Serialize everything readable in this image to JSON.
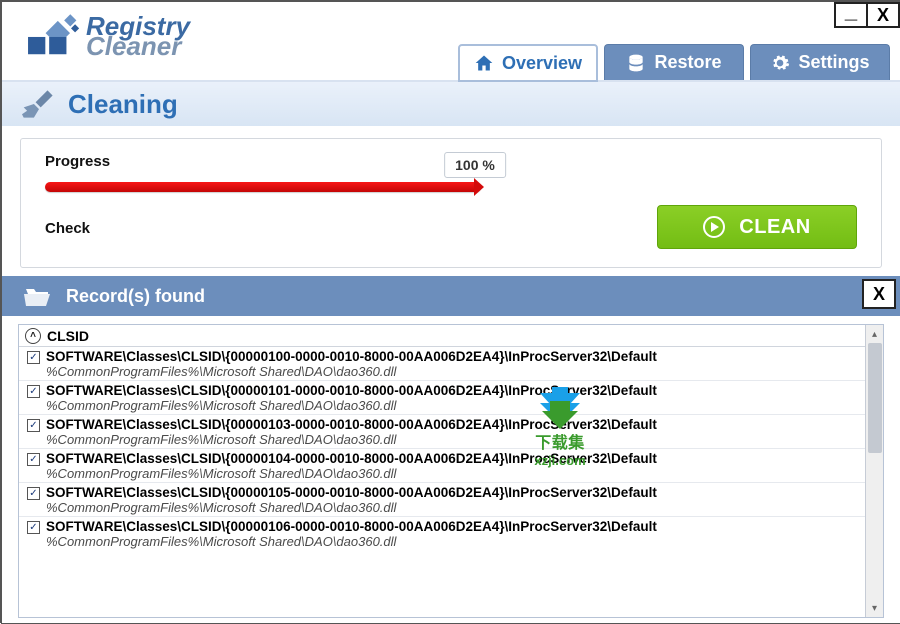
{
  "app": {
    "logo_line1": "Registry",
    "logo_line2": "Cleaner"
  },
  "window_controls": {
    "minimize": "_",
    "close": "X"
  },
  "tabs": {
    "overview": "Overview",
    "restore": "Restore",
    "settings": "Settings"
  },
  "section": {
    "title": "Cleaning"
  },
  "progress": {
    "label": "Progress",
    "value_text": "100 %",
    "percent": 100,
    "check_label": "Check",
    "clean_button": "CLEAN"
  },
  "records": {
    "title": "Record(s) found",
    "close": "X",
    "group": "CLSID",
    "items": [
      {
        "path": "SOFTWARE\\Classes\\CLSID\\{00000100-0000-0010-8000-00AA006D2EA4}\\InProcServer32\\Default",
        "sub": "%CommonProgramFiles%\\Microsoft Shared\\DAO\\dao360.dll",
        "checked": true
      },
      {
        "path": "SOFTWARE\\Classes\\CLSID\\{00000101-0000-0010-8000-00AA006D2EA4}\\InProcServer32\\Default",
        "sub": "%CommonProgramFiles%\\Microsoft Shared\\DAO\\dao360.dll",
        "checked": true
      },
      {
        "path": "SOFTWARE\\Classes\\CLSID\\{00000103-0000-0010-8000-00AA006D2EA4}\\InProcServer32\\Default",
        "sub": "%CommonProgramFiles%\\Microsoft Shared\\DAO\\dao360.dll",
        "checked": true
      },
      {
        "path": "SOFTWARE\\Classes\\CLSID\\{00000104-0000-0010-8000-00AA006D2EA4}\\InProcServer32\\Default",
        "sub": "%CommonProgramFiles%\\Microsoft Shared\\DAO\\dao360.dll",
        "checked": true
      },
      {
        "path": "SOFTWARE\\Classes\\CLSID\\{00000105-0000-0010-8000-00AA006D2EA4}\\InProcServer32\\Default",
        "sub": "%CommonProgramFiles%\\Microsoft Shared\\DAO\\dao360.dll",
        "checked": true
      },
      {
        "path": "SOFTWARE\\Classes\\CLSID\\{00000106-0000-0010-8000-00AA006D2EA4}\\InProcServer32\\Default",
        "sub": "%CommonProgramFiles%\\Microsoft Shared\\DAO\\dao360.dll",
        "checked": true
      }
    ]
  },
  "watermark": {
    "line1": "下载集",
    "line2": "xzji.com"
  }
}
